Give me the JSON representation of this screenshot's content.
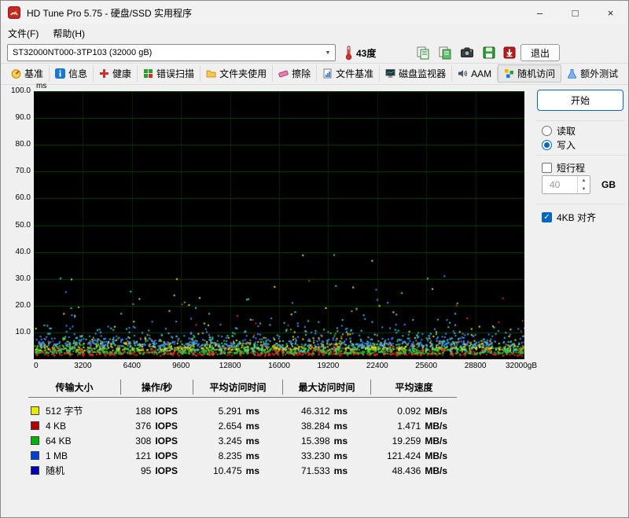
{
  "window": {
    "title": "HD Tune Pro 5.75 - 硬盘/SSD 实用程序",
    "controls": {
      "minimize": "–",
      "maximize": "□",
      "close": "×"
    }
  },
  "menus": {
    "file": "文件(F)",
    "help": "帮助(H)"
  },
  "toolbar": {
    "drive_select": "ST32000NT000-3TP103 (32000 gB)",
    "temperature": "43度",
    "exit": "退出"
  },
  "tabs": [
    {
      "label": "基准"
    },
    {
      "label": "信息"
    },
    {
      "label": "健康"
    },
    {
      "label": "错误扫描"
    },
    {
      "label": "文件夹使用"
    },
    {
      "label": "擦除"
    },
    {
      "label": "文件基准"
    },
    {
      "label": "磁盘监视器"
    },
    {
      "label": "AAM"
    },
    {
      "label": "随机访问"
    },
    {
      "label": "额外测试"
    }
  ],
  "controls": {
    "start": "开始",
    "read": "读取",
    "write": "写入",
    "read_selected": false,
    "write_selected": true,
    "short_stroke": "短行程",
    "short_stroke_checked": false,
    "capacity_value": "40",
    "capacity_unit": "GB",
    "align_4kb": "4KB 对齐",
    "align_4kb_checked": true,
    "check_glyph": "✓"
  },
  "chart_data": {
    "type": "scatter",
    "ylabel": "ms",
    "ylim": [
      0,
      100
    ],
    "xlim": [
      0,
      32000
    ],
    "y_tick_labels": [
      "100.0",
      "90.0",
      "80.0",
      "70.0",
      "60.0",
      "50.0",
      "40.0",
      "30.0",
      "20.0",
      "10.0"
    ],
    "x_tick_labels": [
      "0",
      "3200",
      "6400",
      "9600",
      "12800",
      "16000",
      "19200",
      "22400",
      "25600",
      "28800",
      "32000gB"
    ],
    "background": "#000000",
    "grid_color": "#004000",
    "grid_color_vertical": "#002400",
    "legend_position": "bottom-table",
    "series": [
      {
        "name": "512 字节",
        "color": "#e8e820",
        "avg_ms": 5.291,
        "max_ms": 46.312,
        "count": 620,
        "base": 3.0,
        "scale": 1.5,
        "tail_prob": 0.07
      },
      {
        "name": "4 KB",
        "color": "#e03020",
        "avg_ms": 2.654,
        "max_ms": 38.284,
        "count": 620,
        "base": 1.2,
        "scale": 1.1,
        "tail_prob": 0.05
      },
      {
        "name": "64 KB",
        "color": "#30cc30",
        "avg_ms": 3.245,
        "max_ms": 15.398,
        "count": 620,
        "base": 1.8,
        "scale": 1.2,
        "tail_prob": 0.1
      },
      {
        "name": "1 MB",
        "color": "#4890ff",
        "avg_ms": 8.235,
        "max_ms": 33.23,
        "count": 500,
        "base": 4.5,
        "scale": 2.2,
        "tail_prob": 0.08
      },
      {
        "name": "随机",
        "color": "#38d0d0",
        "avg_ms": 10.475,
        "max_ms": 71.533,
        "count": 340,
        "base": 2.5,
        "scale": 3.5,
        "tail_prob": 0.1
      }
    ]
  },
  "results": {
    "headers": [
      "传输大小",
      "操作/秒",
      "平均访问时间",
      "最大访问时间",
      "平均速度"
    ],
    "rows": [
      {
        "color": "#e8e800",
        "size": "512 字节",
        "iops": "188",
        "iops_unit": "IOPS",
        "avg": "5.291",
        "avg_unit": "ms",
        "max": "46.312",
        "max_unit": "ms",
        "speed": "0.092",
        "speed_unit": "MB/s"
      },
      {
        "color": "#b40000",
        "size": "4 KB",
        "iops": "376",
        "iops_unit": "IOPS",
        "avg": "2.654",
        "avg_unit": "ms",
        "max": "38.284",
        "max_unit": "ms",
        "speed": "1.471",
        "speed_unit": "MB/s"
      },
      {
        "color": "#00b400",
        "size": "64 KB",
        "iops": "308",
        "iops_unit": "IOPS",
        "avg": "3.245",
        "avg_unit": "ms",
        "max": "15.398",
        "max_unit": "ms",
        "speed": "19.259",
        "speed_unit": "MB/s"
      },
      {
        "color": "#0040d8",
        "size": "1 MB",
        "iops": "121",
        "iops_unit": "IOPS",
        "avg": "8.235",
        "avg_unit": "ms",
        "max": "33.230",
        "max_unit": "ms",
        "speed": "121.424",
        "speed_unit": "MB/s"
      },
      {
        "color": "#0000b8",
        "size": "随机",
        "iops": "95",
        "iops_unit": "IOPS",
        "avg": "10.475",
        "avg_unit": "ms",
        "max": "71.533",
        "max_unit": "ms",
        "speed": "48.436",
        "speed_unit": "MB/s"
      }
    ]
  }
}
